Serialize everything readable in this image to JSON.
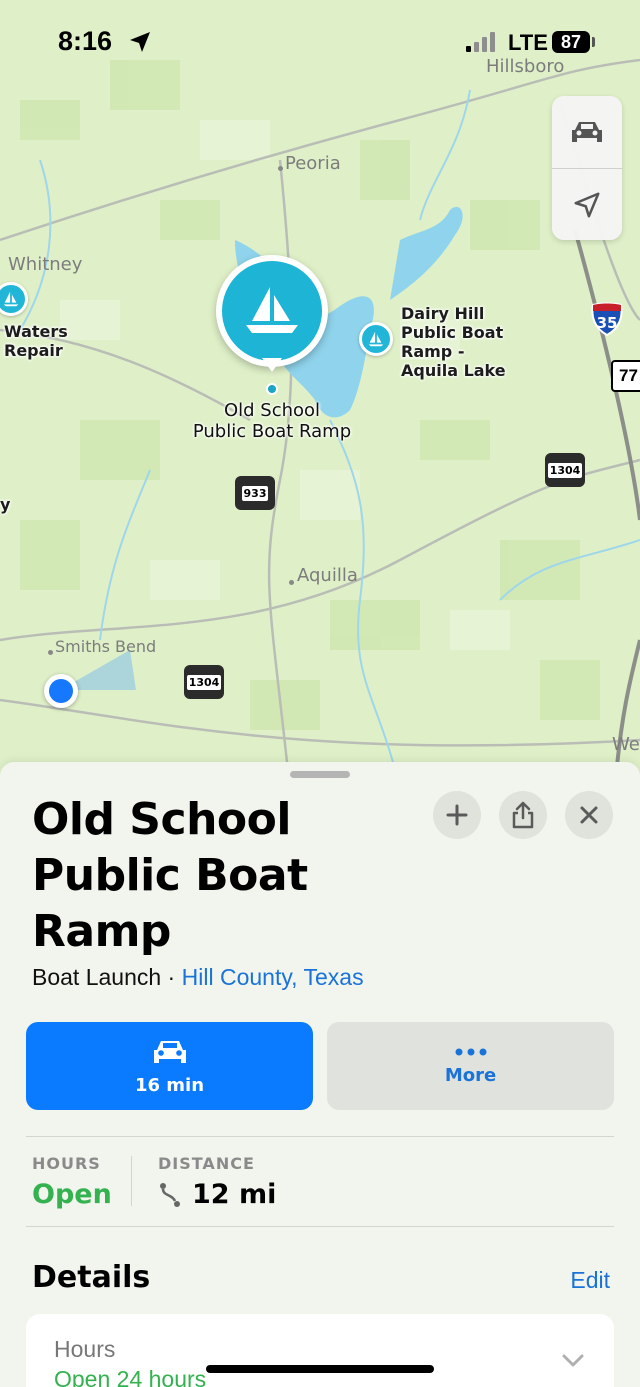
{
  "status": {
    "time": "8:16",
    "network": "LTE",
    "battery": "87"
  },
  "map": {
    "towns": {
      "hillsboro": "Hillsboro",
      "peoria": "Peoria",
      "whitney": "Whitney",
      "aquilla": "Aquilla",
      "smiths_bend": "Smiths Bend",
      "west_partial": "We",
      "left_partial": "y"
    },
    "pois": {
      "waters_repair": "Waters\nRepair",
      "dairy_hill": "Dairy Hill\nPublic Boat\nRamp -\nAquila Lake"
    },
    "selected_pin_label": "Old School\nPublic Boat Ramp",
    "highways": {
      "interstate": "35",
      "us": "77",
      "fm_933": "933",
      "fm_1304_a": "1304",
      "fm_1304_b": "1304"
    },
    "colors": {
      "water": "#8fd4ec",
      "pin": "#1db4d6",
      "user": "#1677ff"
    }
  },
  "place": {
    "title": "Old School Public Boat Ramp",
    "category": "Boat Launch",
    "separator": " · ",
    "location": "Hill County, Texas"
  },
  "actions": {
    "drive_label": "16 min",
    "more_label": "More"
  },
  "info": {
    "hours_heading": "HOURS",
    "hours_value": "Open",
    "distance_heading": "DISTANCE",
    "distance_value": "12 mi"
  },
  "details": {
    "heading": "Details",
    "edit_label": "Edit",
    "hours_label": "Hours",
    "hours_value": "Open 24 hours"
  },
  "colors": {
    "accent": "#0a7afe",
    "link": "#1a73d9",
    "open": "#34b24f"
  }
}
